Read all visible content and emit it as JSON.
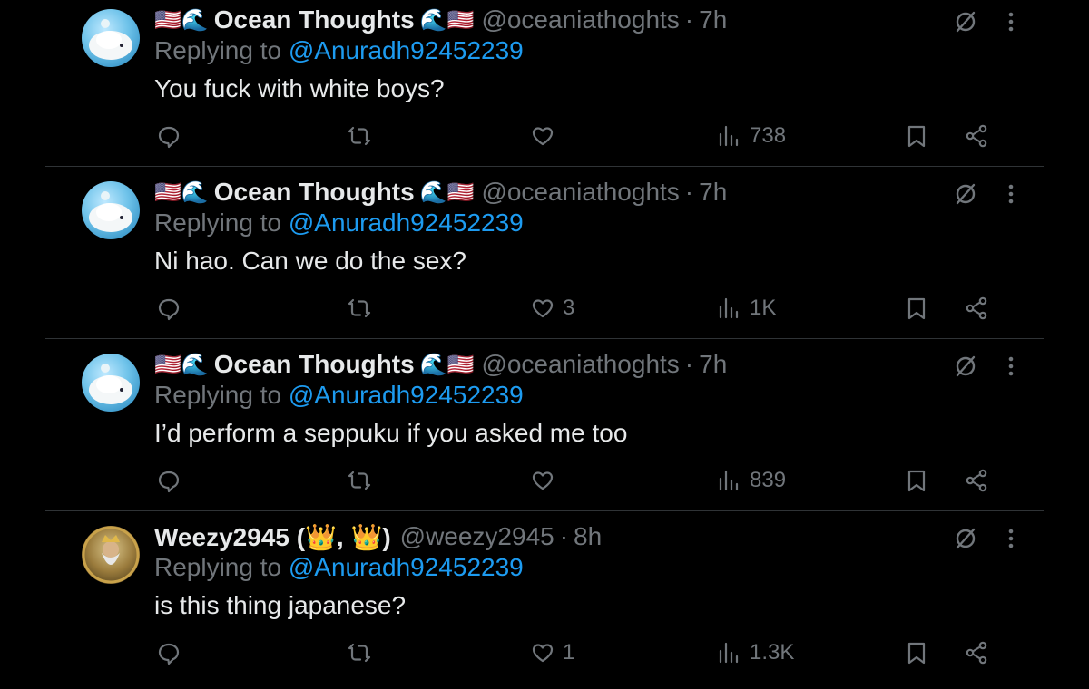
{
  "tweets": [
    {
      "name": "Ocean Thoughts",
      "flags_before": "🇺🇸🌊",
      "flags_after": "🌊🇺🇸",
      "handle": "@oceaniathoghts",
      "time": "7h",
      "replying_prefix": "Replying to",
      "replying_to": "@Anuradh92452239",
      "text": "You fuck with white boys?",
      "likes": "",
      "views": "738"
    },
    {
      "name": "Ocean Thoughts",
      "flags_before": "🇺🇸🌊",
      "flags_after": "🌊🇺🇸",
      "handle": "@oceaniathoghts",
      "time": "7h",
      "replying_prefix": "Replying to",
      "replying_to": "@Anuradh92452239",
      "text": "Ni hao. Can we do the sex?",
      "likes": "3",
      "views": "1K"
    },
    {
      "name": "Ocean Thoughts",
      "flags_before": "🇺🇸🌊",
      "flags_after": "🌊🇺🇸",
      "handle": "@oceaniathoghts",
      "time": "7h",
      "replying_prefix": "Replying to",
      "replying_to": "@Anuradh92452239",
      "text": "I’d perform a seppuku if you asked me too",
      "likes": "",
      "views": "839"
    },
    {
      "name": "Weezy2945 (👑, 👑)",
      "flags_before": "",
      "flags_after": "",
      "handle": "@weezy2945",
      "time": "8h",
      "replying_prefix": "Replying to",
      "replying_to": "@Anuradh92452239",
      "text": "is this thing japanese?",
      "likes": "1",
      "views": "1.3K"
    }
  ],
  "separator": "·",
  "icons": {
    "reply": "reply-icon",
    "retweet": "retweet-icon",
    "like": "heart-icon",
    "views": "views-icon",
    "bookmark": "bookmark-icon",
    "share": "share-icon",
    "grok": "grok-icon",
    "more": "more-icon"
  },
  "colors": {
    "background": "#000000",
    "text": "#e7e9ea",
    "secondary": "#71767b",
    "link": "#1d9bf0",
    "divider": "#2f3336"
  }
}
